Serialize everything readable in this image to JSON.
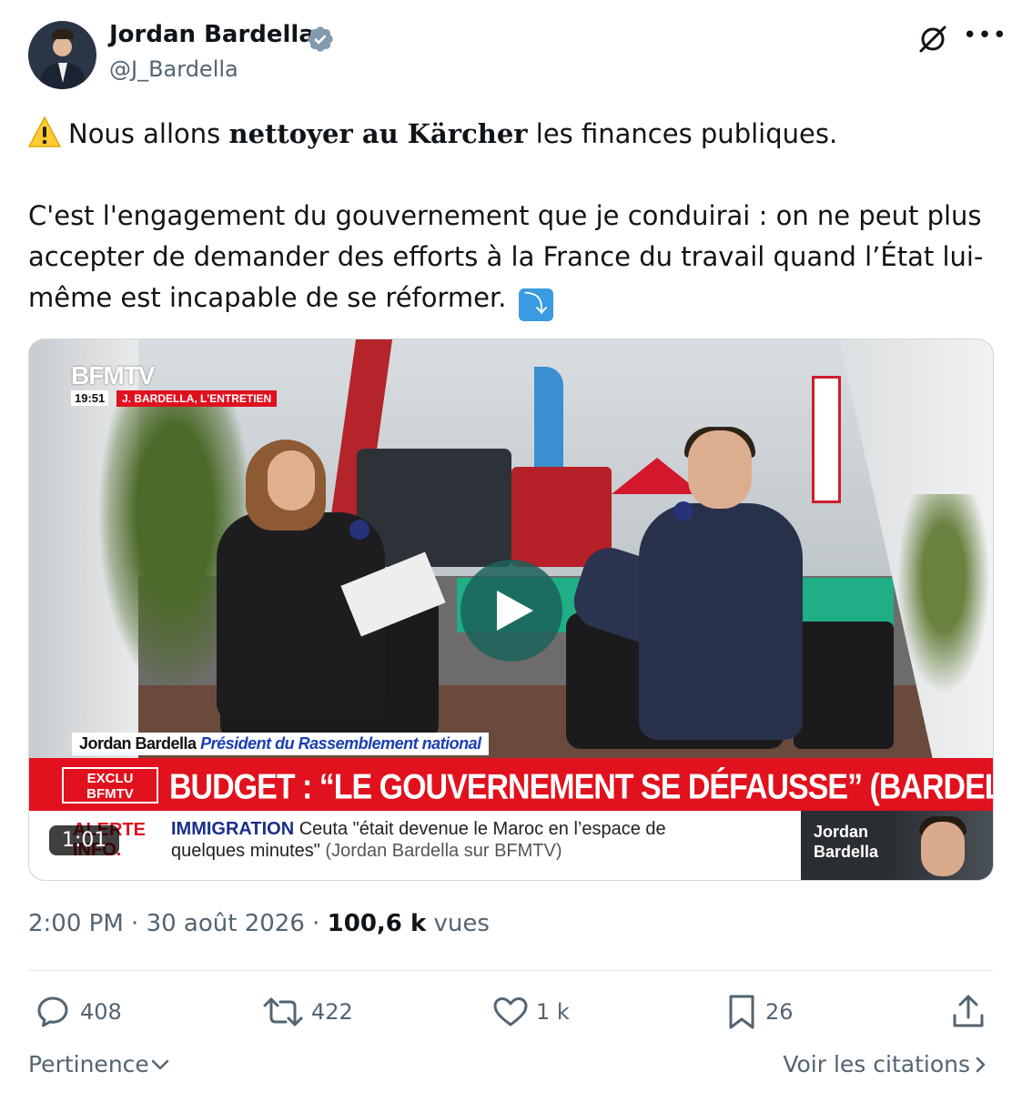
{
  "author": {
    "name": "Jordan Bardella",
    "handle": "@J_Bardella",
    "verified": true,
    "verified_color": "#829aab"
  },
  "tweet": {
    "warning_icon": "warning-emoji",
    "line1_pre": "Nous allons ",
    "line1_bold": "nettoyer au Kärcher",
    "line1_post": " les finances publiques.",
    "paragraph2": "C'est l'engagement du gouvernement que je conduirai : on ne peut plus accepter de demander des efforts à la France du travail quand l’État lui-même est incapable de se réformer.",
    "arrow_emoji": "⤵"
  },
  "video": {
    "channel_logo": "BFMTV",
    "time": "19:51",
    "tag": "J. BARDELLA, L'ENTRETIEN",
    "lower_third_name": "Jordan Bardella",
    "lower_third_role": "Président du Rassemblement national",
    "exclu_line1": "EXCLU",
    "exclu_line2": "BFMTV",
    "headline": "BUDGET : “LE GOUVERNEMENT SE DÉFAUSSE” (BARDELLA)",
    "alert_line1": "ALERTE",
    "alert_line2": "INFO.",
    "ticker_bold": "IMMIGRATION",
    "ticker_line1": " Ceuta \"était devenue le Maroc en l’espace de",
    "ticker_line2": "quelques minutes\"",
    "ticker_source": " (Jordan Bardella sur BFMTV)",
    "thumb_line1": "Jordan",
    "thumb_line2": "Bardella",
    "duration": "1:01",
    "play_color": "#1c625a"
  },
  "meta": {
    "time": "2:00 PM",
    "sep1": " · ",
    "date": "30 août 2026",
    "sep2": " · ",
    "views_count": "100,6 k",
    "views_label": " vues"
  },
  "actions": {
    "reply_count": "408",
    "retweet_count": "422",
    "like_count": "1 k",
    "bookmark_count": "26"
  },
  "footer": {
    "sort_label": "Pertinence",
    "citations_label": "Voir les citations"
  },
  "colors": {
    "text_primary": "#0f1419",
    "text_secondary": "#536471",
    "bfm_red": "#e1111d"
  }
}
